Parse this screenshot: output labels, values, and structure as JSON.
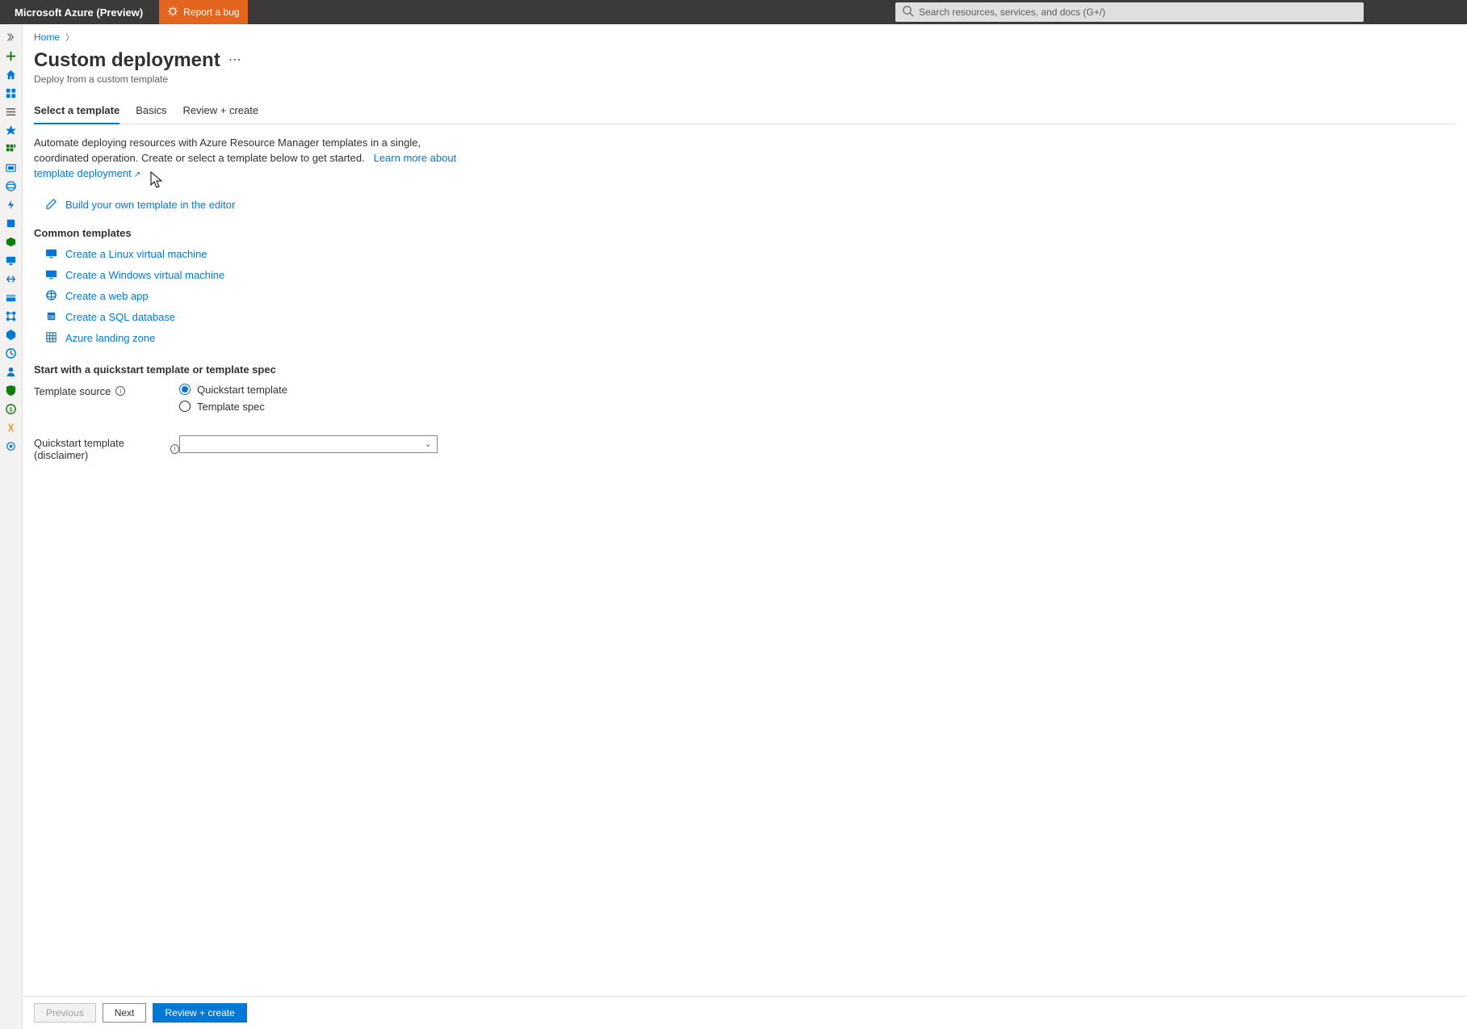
{
  "header": {
    "brand": "Microsoft Azure (Preview)",
    "bug_label": "Report a bug",
    "search_placeholder": "Search resources, services, and docs (G+/)"
  },
  "breadcrumb": {
    "home": "Home"
  },
  "page": {
    "title": "Custom deployment",
    "subtitle": "Deploy from a custom template"
  },
  "tabs": {
    "select_template": "Select a template",
    "basics": "Basics",
    "review_create": "Review + create"
  },
  "intro": {
    "text": "Automate deploying resources with Azure Resource Manager templates in a single, coordinated operation. Create or select a template below to get started.",
    "link": "Learn more about template deployment"
  },
  "editor_link": "Build your own template in the editor",
  "common": {
    "heading": "Common templates",
    "items": [
      "Create a Linux virtual machine",
      "Create a Windows virtual machine",
      "Create a web app",
      "Create a SQL database",
      "Azure landing zone"
    ]
  },
  "quickstart": {
    "heading": "Start with a quickstart template or template spec",
    "source_label": "Template source",
    "radio_quickstart": "Quickstart template",
    "radio_spec": "Template spec",
    "disclaimer_label": "Quickstart template (disclaimer)"
  },
  "footer": {
    "previous": "Previous",
    "next": "Next",
    "review_create": "Review + create"
  }
}
